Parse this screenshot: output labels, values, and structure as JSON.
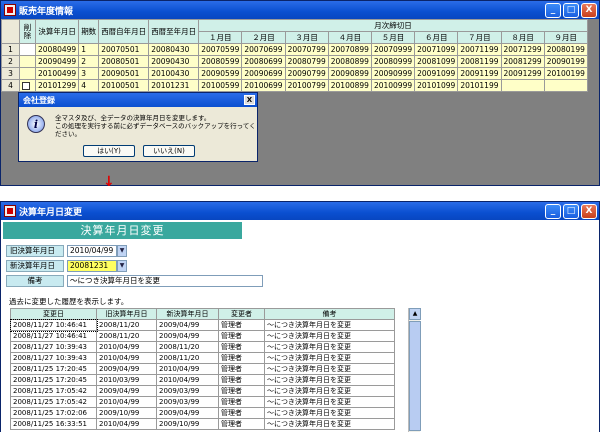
{
  "win1": {
    "title": "販売年度情報",
    "headers": {
      "delete": "削除",
      "settle": "決算年月日",
      "period": "期数",
      "from": "西暦自年月日",
      "to": "西暦至年月日",
      "monthly_group": "月次締切日",
      "months": [
        "１月目",
        "２月目",
        "３月目",
        "４月目",
        "５月目",
        "６月目",
        "７月目",
        "８月目",
        "９月目"
      ]
    },
    "rows": [
      {
        "num": "1",
        "settle": "20080499",
        "period": "1",
        "from": "20070501",
        "to": "20080430",
        "months": [
          "20070599",
          "20070699",
          "20070799",
          "20070899",
          "20070999",
          "20071099",
          "20071199",
          "20071299",
          "20080199"
        ]
      },
      {
        "num": "2",
        "settle": "20090499",
        "period": "2",
        "from": "20080501",
        "to": "20090430",
        "months": [
          "20080599",
          "20080699",
          "20080799",
          "20080899",
          "20080999",
          "20081099",
          "20081199",
          "20081299",
          "20090199"
        ]
      },
      {
        "num": "3",
        "settle": "20100499",
        "period": "3",
        "from": "20090501",
        "to": "20100430",
        "months": [
          "20090599",
          "20090699",
          "20090799",
          "20090899",
          "20090999",
          "20091099",
          "20091199",
          "20091299",
          "20100199"
        ]
      },
      {
        "num": "4",
        "settle": "20101299",
        "period": "4",
        "from": "20100501",
        "to": "20101231",
        "months": [
          "20100599",
          "20100699",
          "20100799",
          "20100899",
          "20100999",
          "20101099",
          "20101199",
          "",
          ""
        ]
      }
    ]
  },
  "dialog": {
    "title": "会社登録",
    "line1": "全マスタ及び、全データの決算年月日を変更します。",
    "line2": "この処理を実行する前に必ずデータベースのバックアップを行ってください。",
    "yes": "はい(Y)",
    "no": "いいえ(N)"
  },
  "arrow": "↓",
  "win2": {
    "title": "決算年月日変更",
    "banner": "決算年月日変更",
    "old_label": "旧決算年月日",
    "old_value": "2010/04/99",
    "new_label": "新決算年月日",
    "new_value": "20081231",
    "note_label": "備考",
    "note_value": "～につき決算年月日を変更",
    "history_label": "過去に変更した履歴を表示します。",
    "history_headers": [
      "変更日",
      "旧決算年月日",
      "新決算年月日",
      "変更者",
      "備考"
    ],
    "history": [
      [
        "2008/11/27 10:46:41",
        "2008/11/20",
        "2009/04/99",
        "管理者",
        "～につき決算年月日を変更"
      ],
      [
        "2008/11/27 10:46:41",
        "2008/11/20",
        "2009/04/99",
        "管理者",
        "～につき決算年月日を変更"
      ],
      [
        "2008/11/27 10:39:43",
        "2010/04/99",
        "2008/11/20",
        "管理者",
        "～につき決算年月日を変更"
      ],
      [
        "2008/11/27 10:39:43",
        "2010/04/99",
        "2008/11/20",
        "管理者",
        "～につき決算年月日を変更"
      ],
      [
        "2008/11/25 17:20:45",
        "2009/04/99",
        "2010/04/99",
        "管理者",
        "～につき決算年月日を変更"
      ],
      [
        "2008/11/25 17:20:45",
        "2010/03/99",
        "2010/04/99",
        "管理者",
        "～につき決算年月日を変更"
      ],
      [
        "2008/11/25 17:05:42",
        "2009/04/99",
        "2009/03/99",
        "管理者",
        "～につき決算年月日を変更"
      ],
      [
        "2008/11/25 17:05:42",
        "2010/04/99",
        "2009/03/99",
        "管理者",
        "～につき決算年月日を変更"
      ],
      [
        "2008/11/25 17:02:06",
        "2009/10/99",
        "2009/04/99",
        "管理者",
        "～につき決算年月日を変更"
      ],
      [
        "2008/11/25 16:33:51",
        "2010/04/99",
        "2009/10/99",
        "管理者",
        "～につき決算年月日を変更"
      ]
    ]
  },
  "controls": {
    "minimize": "_",
    "maximize": "□",
    "close": "X",
    "dropdown": "▼",
    "scroll_up": "▲"
  }
}
